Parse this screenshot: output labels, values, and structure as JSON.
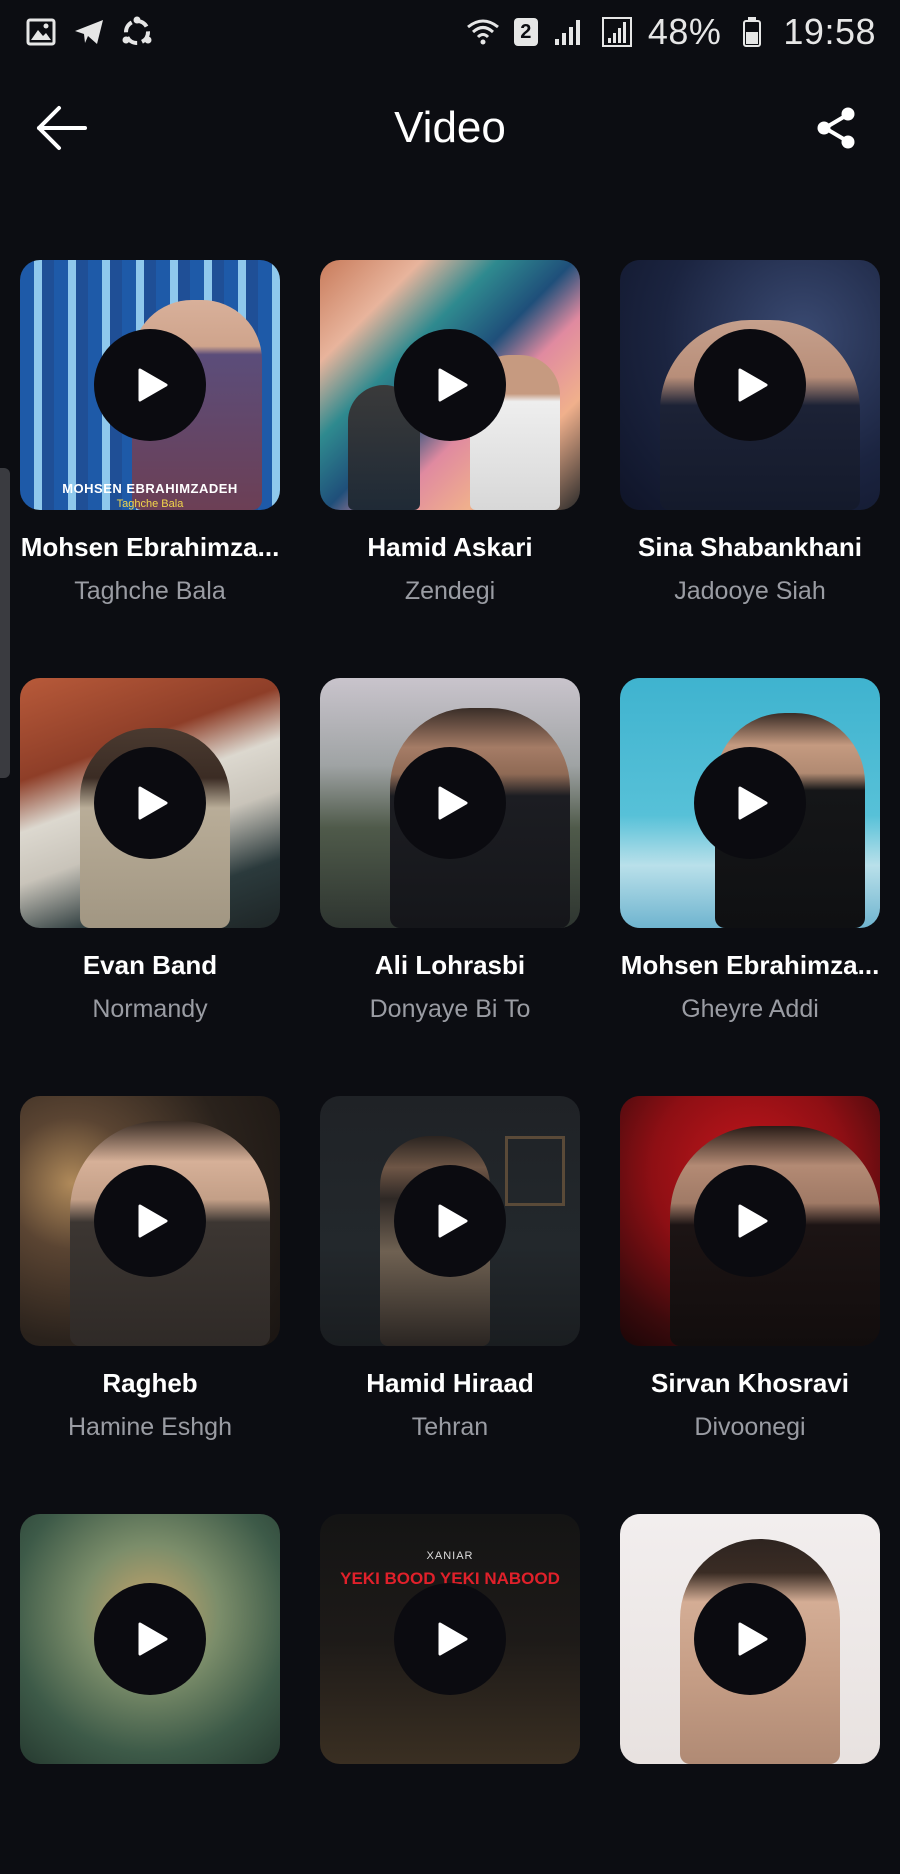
{
  "status_bar": {
    "battery": "48%",
    "time": "19:58",
    "sim_badge": "2",
    "left_icons": [
      "gallery-icon",
      "telegram-icon",
      "share-it-icon"
    ],
    "right_icons": [
      "wifi-icon",
      "signal-icon",
      "signal-icon",
      "battery-icon"
    ]
  },
  "header": {
    "title": "Video",
    "back_icon": "arrow-left-icon",
    "share_icon": "share-icon"
  },
  "videos": [
    {
      "artist": "Mohsen Ebrahimza...",
      "song": "Taghche Bala",
      "overlay_line1": "MOHSEN EBRAHIMZADEH",
      "overlay_line2": "Taghche Bala"
    },
    {
      "artist": "Hamid Askari",
      "song": "Zendegi"
    },
    {
      "artist": "Sina Shabankhani",
      "song": "Jadooye Siah"
    },
    {
      "artist": "Evan Band",
      "song": "Normandy"
    },
    {
      "artist": "Ali Lohrasbi",
      "song": "Donyaye Bi To"
    },
    {
      "artist": "Mohsen Ebrahimza...",
      "song": "Gheyre Addi"
    },
    {
      "artist": "Ragheb",
      "song": "Hamine Eshgh"
    },
    {
      "artist": "Hamid Hiraad",
      "song": "Tehran"
    },
    {
      "artist": "Sirvan Khosravi",
      "song": "Divoonegi"
    },
    {
      "artist": "",
      "song": ""
    },
    {
      "artist": "",
      "song": "",
      "overlay_line1": "XANIAR",
      "overlay_line2": "YEKI BOOD YEKI NABOOD"
    },
    {
      "artist": "",
      "song": ""
    }
  ],
  "colors": {
    "background": "#0c0d12",
    "play_button": "#0b0b10",
    "subtitle": "#9a9ca3"
  }
}
